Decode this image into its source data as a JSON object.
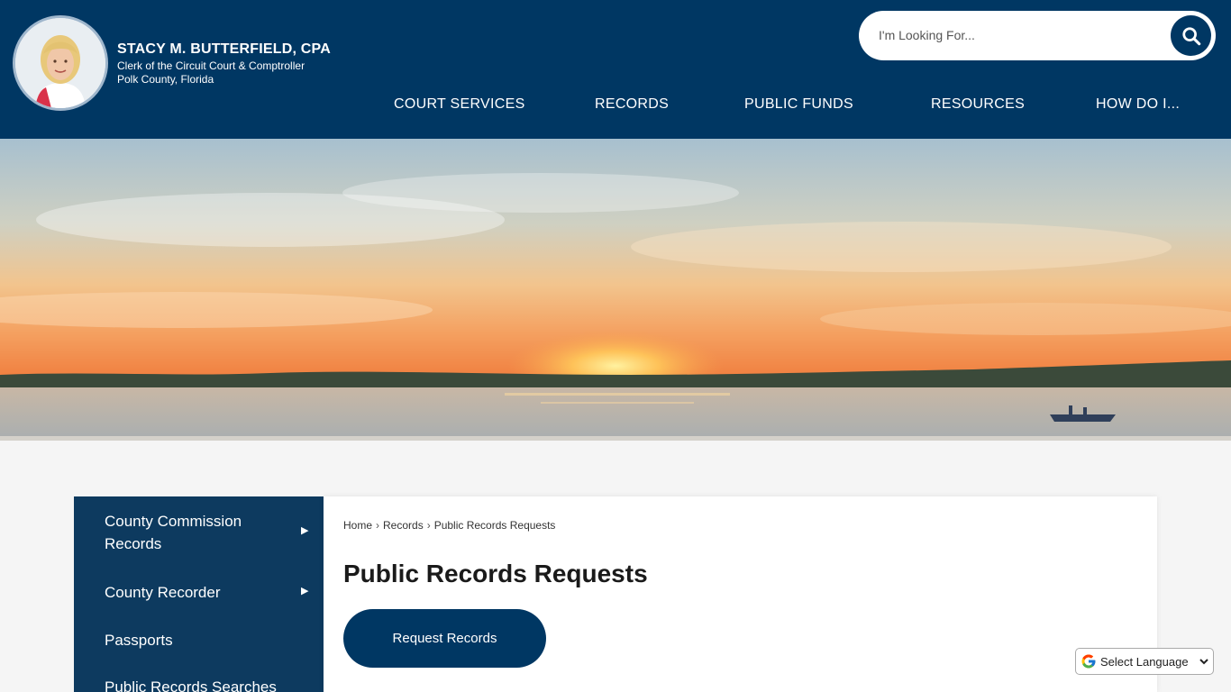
{
  "brand": {
    "name": "STACY M. BUTTERFIELD, CPA",
    "subtitle": "Clerk of the Circuit Court & Comptroller",
    "location": "Polk County, Florida"
  },
  "search": {
    "placeholder": "I'm Looking For..."
  },
  "nav": {
    "items": [
      {
        "label": "COURT SERVICES"
      },
      {
        "label": "RECORDS"
      },
      {
        "label": "PUBLIC FUNDS"
      },
      {
        "label": "RESOURCES"
      },
      {
        "label": "HOW DO I..."
      }
    ]
  },
  "sidebar": {
    "items": [
      {
        "label": "County Commission Records",
        "has_submenu": true
      },
      {
        "label": "County Recorder",
        "has_submenu": true
      },
      {
        "label": "Passports",
        "has_submenu": false
      },
      {
        "label": "Public Records Searches",
        "has_submenu": false
      }
    ]
  },
  "breadcrumb": {
    "items": [
      "Home",
      "Records",
      "Public Records Requests"
    ],
    "separator": "›"
  },
  "page": {
    "title": "Public Records Requests",
    "primary_button": "Request Records"
  },
  "translate": {
    "label": "Select Language"
  },
  "colors": {
    "header_bg": "#003763",
    "sidebar_bg": "#0d3a5f",
    "button_bg": "#003763",
    "page_bg": "#f5f5f5"
  },
  "icons": {
    "search": "search-icon",
    "submenu": "triangle-right-icon",
    "google": "google-g-icon"
  }
}
